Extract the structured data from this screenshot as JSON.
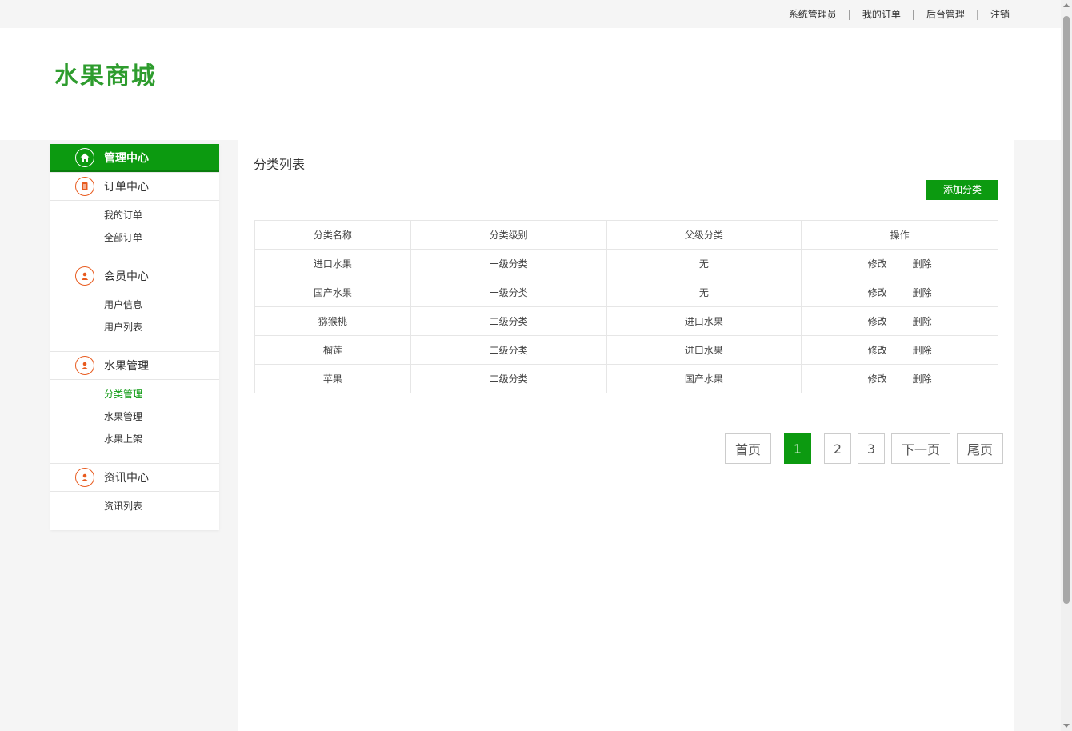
{
  "topnav": {
    "user": "系统管理员",
    "orders": "我的订单",
    "admin": "后台管理",
    "logout": "注销",
    "separator": "|"
  },
  "header": {
    "logo": "水果商城"
  },
  "sidebar": {
    "home": {
      "label": "管理中心",
      "icon": "home-icon"
    },
    "groups": [
      {
        "label": "订单中心",
        "icon": "document-icon",
        "items": [
          "我的订单",
          "全部订单"
        ]
      },
      {
        "label": "会员中心",
        "icon": "user-icon",
        "items": [
          "用户信息",
          "用户列表"
        ]
      },
      {
        "label": "水果管理",
        "icon": "user-icon",
        "items": [
          "分类管理",
          "水果管理",
          "水果上架"
        ]
      },
      {
        "label": "资讯中心",
        "icon": "user-icon",
        "items": [
          "资讯列表"
        ]
      }
    ],
    "current_item": "分类管理"
  },
  "main": {
    "title": "分类列表",
    "add_button": "添加分类",
    "table": {
      "headers": [
        "分类名称",
        "分类级别",
        "父级分类",
        "操作"
      ],
      "rows": [
        {
          "name": "进口水果",
          "level": "一级分类",
          "parent": "无"
        },
        {
          "name": "国产水果",
          "level": "一级分类",
          "parent": "无"
        },
        {
          "name": "猕猴桃",
          "level": "二级分类",
          "parent": "进口水果"
        },
        {
          "name": "榴莲",
          "level": "二级分类",
          "parent": "进口水果"
        },
        {
          "name": "苹果",
          "level": "二级分类",
          "parent": "国产水果"
        }
      ],
      "edit_label": "修改",
      "delete_label": "删除"
    },
    "pager": {
      "first": "首页",
      "pages": [
        "1",
        "2",
        "3"
      ],
      "current": "1",
      "next": "下一页",
      "last": "尾页"
    }
  },
  "colors": {
    "accent": "#0c9a10",
    "icon_orange": "#e85b1f",
    "logo_green": "#2e9c2e"
  }
}
